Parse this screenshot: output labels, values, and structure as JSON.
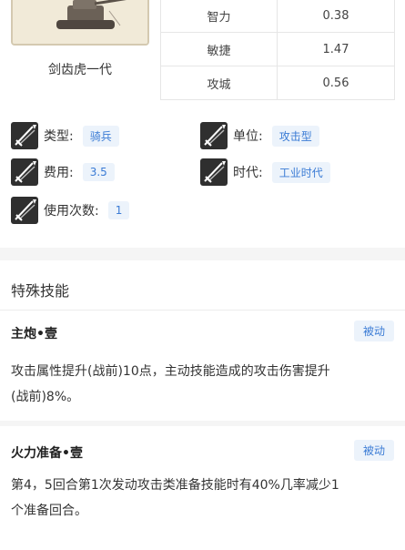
{
  "unit": {
    "name": "剑齿虎一代"
  },
  "stats": [
    {
      "key": "智力",
      "value": "0.38"
    },
    {
      "key": "敏捷",
      "value": "1.47"
    },
    {
      "key": "攻城",
      "value": "0.56"
    }
  ],
  "attributes": {
    "type_label": "类型:",
    "type_value": "骑兵",
    "unit_label": "单位:",
    "unit_value": "攻击型",
    "cost_label": "费用:",
    "cost_value": "3.5",
    "era_label": "时代:",
    "era_value": "工业时代",
    "uses_label": "使用次数:",
    "uses_value": "1"
  },
  "section": {
    "title": "特殊技能"
  },
  "skills": [
    {
      "name": "主炮•壹",
      "tag": "被动",
      "desc_line1": "攻击属性提升(战前)10点，主动技能造成的攻击伤害提升",
      "desc_line2": "(战前)8%。"
    },
    {
      "name": "火力准备•壹",
      "tag": "被动",
      "desc_line1": "第4，5回合第1次发动攻击类准备技能时有40%几率减少1",
      "desc_line2": "个准备回合。"
    }
  ],
  "icons": {
    "attribute_icon": "crossed-swords-icon",
    "portrait": "tank-portrait-icon"
  },
  "colors": {
    "chip_bg": "#ecf3fb",
    "chip_text": "#3a7bd5",
    "portrait_bg": "#f1ead8"
  }
}
